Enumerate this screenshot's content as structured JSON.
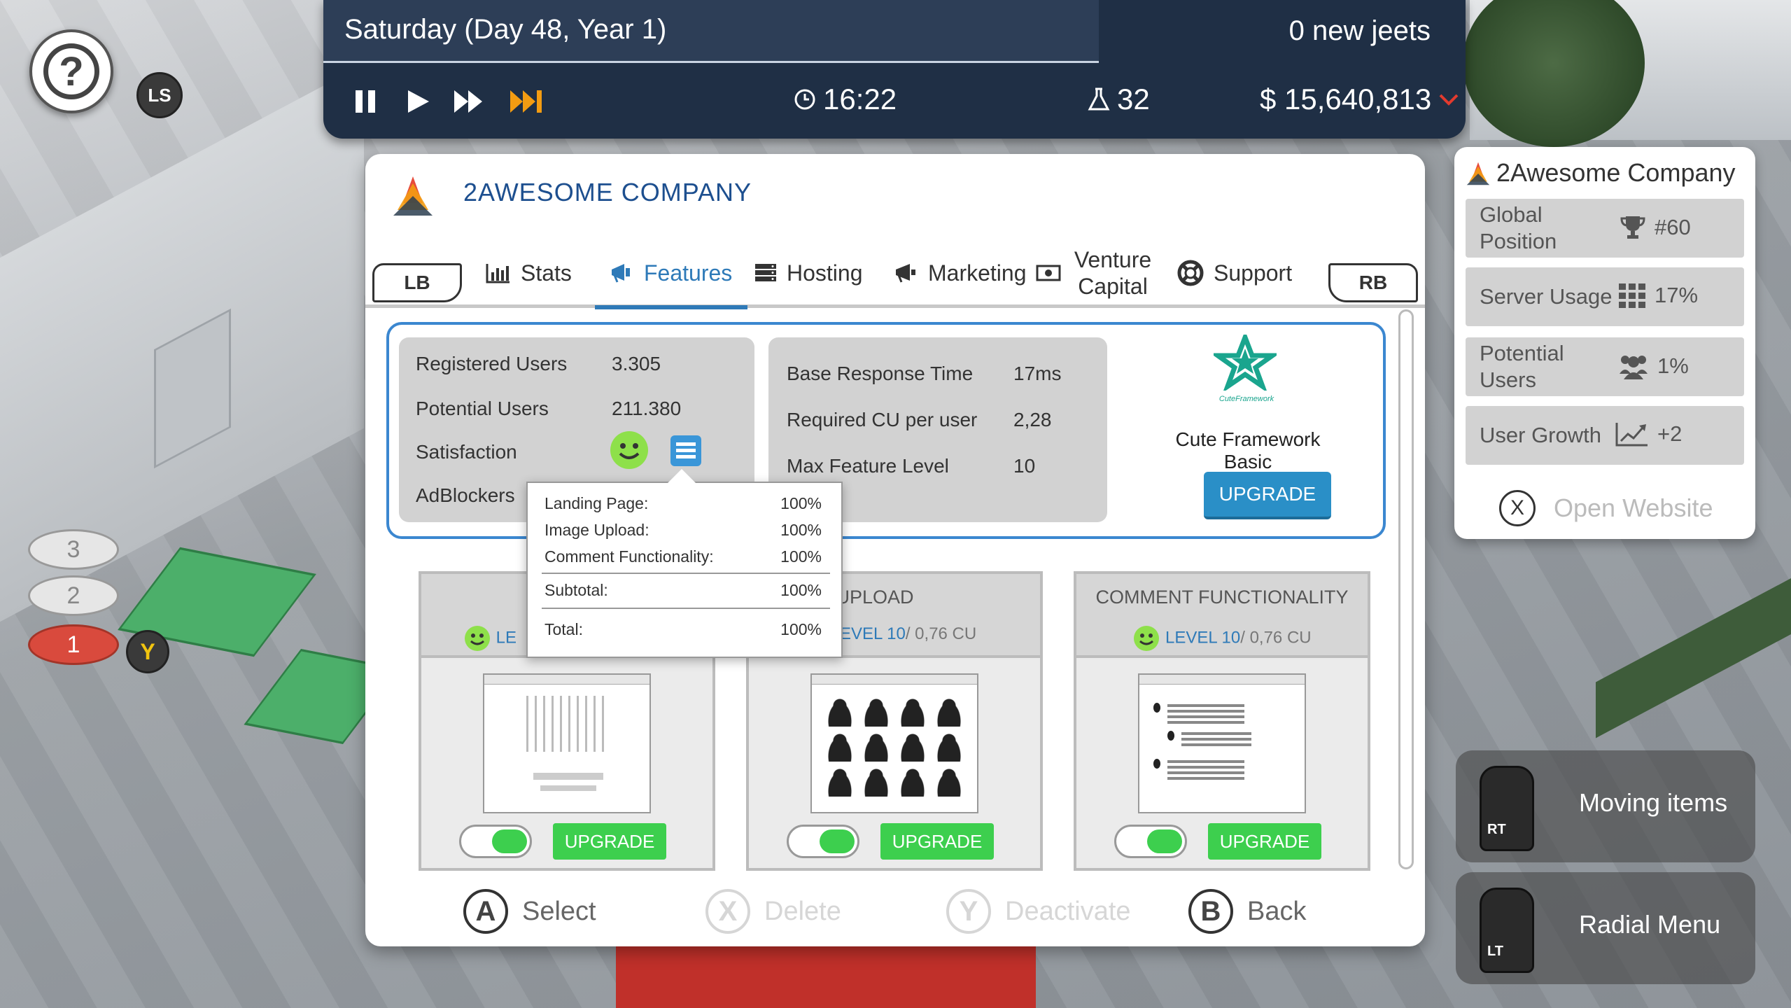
{
  "hud": {
    "help_icon": "question-mark-icon",
    "ls_label": "LS",
    "date": "Saturday (Day 48, Year 1)",
    "new_jeets": "0 new jeets",
    "time": "16:22",
    "research": "32",
    "money": "$ 15,640,813",
    "accent_color": "#f39c12"
  },
  "panel": {
    "company_title": "2AWESOME COMPANY",
    "tabs": [
      {
        "label": "Stats",
        "icon": "bar-chart-icon"
      },
      {
        "label": "Features",
        "icon": "megaphone-flag-icon"
      },
      {
        "label": "Hosting",
        "icon": "server-icon"
      },
      {
        "label": "Marketing",
        "icon": "megaphone-icon"
      },
      {
        "label": "Venture Capital",
        "icon": "money-icon"
      },
      {
        "label": "Support",
        "icon": "lifebuoy-icon"
      }
    ],
    "active_tab": "Features",
    "lb": "LB",
    "rb": "RB",
    "stats_left": {
      "registered_users_label": "Registered Users",
      "registered_users": "3.305",
      "potential_users_label": "Potential Users",
      "potential_users": "211.380",
      "satisfaction_label": "Satisfaction",
      "adblockers_label": "AdBlockers"
    },
    "stats_mid": {
      "base_response_label": "Base Response Time",
      "base_response": "17ms",
      "cu_label": "Required CU per user",
      "cu": "2,28",
      "max_level_label": "Max Feature Level",
      "max_level": "10"
    },
    "framework": {
      "logo_text": "CuteFramework",
      "name": "Cute Framework Basic",
      "upgrade": "UPGRADE"
    },
    "tooltip": {
      "rows": [
        {
          "label": "Landing Page:",
          "value": "100%"
        },
        {
          "label": "Image Upload:",
          "value": "100%"
        },
        {
          "label": "Comment Functionality:",
          "value": "100%"
        }
      ],
      "subtotal_label": "Subtotal:",
      "subtotal": "100%",
      "total_label": "Total:",
      "total": "100%"
    },
    "features": [
      {
        "title": "LA",
        "level_label": "LE",
        "level_rest": "",
        "upgrade": "UPGRADE",
        "enabled": true
      },
      {
        "title": "AGE UPLOAD",
        "level_label": "EVEL 10",
        "level_rest": "/ 0,76 CU",
        "upgrade": "UPGRADE",
        "enabled": true
      },
      {
        "title": "COMMENT FUNCTIONALITY",
        "level_label": "LEVEL 10",
        "level_rest": "/ 0,76 CU",
        "upgrade": "UPGRADE",
        "enabled": true
      }
    ],
    "actions": [
      {
        "key": "A",
        "label": "Select"
      },
      {
        "key": "X",
        "label": "Delete"
      },
      {
        "key": "Y",
        "label": "Deactivate"
      },
      {
        "key": "B",
        "label": "Back"
      }
    ]
  },
  "side": {
    "company": "2Awesome Company",
    "global_position_label": "Global Position",
    "global_position": "#60",
    "server_usage_label": "Server Usage",
    "server_usage": "17%",
    "potential_users_label": "Potential Users",
    "potential_users": "1%",
    "user_growth_label": "User Growth",
    "user_growth": "+2",
    "open_website_key": "X",
    "open_website": "Open Website"
  },
  "triggers": [
    {
      "key": "RT",
      "label": "Moving items"
    },
    {
      "key": "LT",
      "label": "Radial Menu"
    }
  ],
  "floors": [
    "3",
    "2",
    "1"
  ],
  "y_badge": "Y"
}
